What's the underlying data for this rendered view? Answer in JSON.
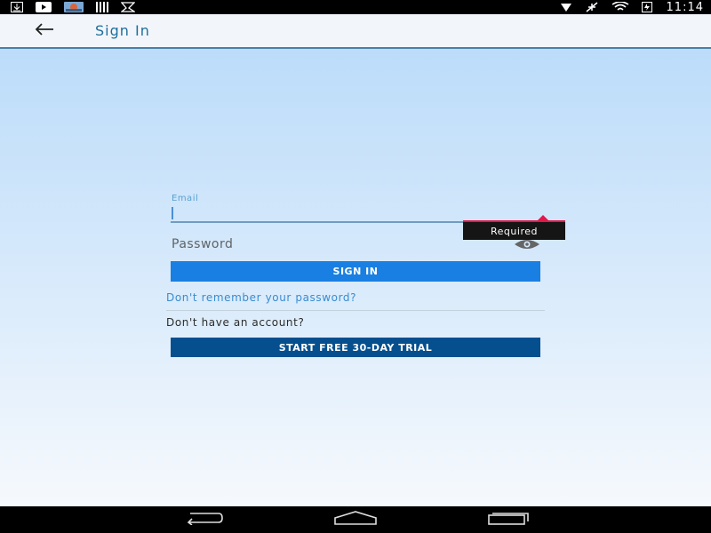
{
  "status_bar": {
    "time": "11:14",
    "left_icons": [
      "download-icon",
      "video-icon",
      "photo-icon",
      "barcode-icon",
      "mail-icon"
    ],
    "right_icons": [
      "signal-icon",
      "airplane-mode-icon",
      "wifi-icon",
      "battery-charging-icon"
    ]
  },
  "app_bar": {
    "title": "Sign In",
    "back_icon": "back-arrow-icon"
  },
  "form": {
    "email_label": "Email",
    "email_value": "",
    "error_tooltip": "Required",
    "password_placeholder": "Password",
    "password_value": "",
    "sign_in_label": "SIGN IN",
    "forgot_password_link": "Don't remember your password?",
    "no_account_text": "Don't have an account?",
    "trial_button_label": "START FREE 30-DAY TRIAL"
  },
  "colors": {
    "accent": "#1a7fe2",
    "trial_button": "#064f8e",
    "error": "#e2174a",
    "title": "#1e6e9c",
    "link": "#3a8cd0"
  },
  "nav_bar": {
    "icons": [
      "back-nav-icon",
      "home-nav-icon",
      "recents-nav-icon"
    ]
  }
}
